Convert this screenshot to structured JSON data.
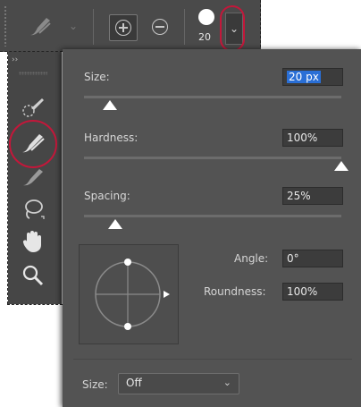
{
  "options_bar": {
    "brush_size_preview": "20",
    "icons": [
      "brush-icon",
      "chevron-down-icon",
      "add-to-selection-icon",
      "subtract-from-selection-icon",
      "brush-preview-icon",
      "dropdown-chevron-icon"
    ]
  },
  "toolbar": {
    "collapse_label": "››",
    "tools": [
      "quick-selection-icon",
      "selection-brush-icon",
      "refine-brush-icon",
      "lasso-icon",
      "hand-icon",
      "zoom-icon"
    ]
  },
  "brush_panel": {
    "size_label": "Size:",
    "size_value": "20 px",
    "size_fraction": 0.1,
    "hardness_label": "Hardness:",
    "hardness_value": "100%",
    "hardness_fraction": 1.0,
    "spacing_label": "Spacing:",
    "spacing_value": "25%",
    "spacing_fraction": 0.12,
    "angle_label": "Angle:",
    "angle_value": "0°",
    "roundness_label": "Roundness:",
    "roundness_value": "100%",
    "pen_size_label": "Size:",
    "pen_size_value": "Off"
  },
  "colors": {
    "panel_bg": "#535353",
    "highlight_ring": "#c3173a",
    "selection_blue": "#2a6fd6"
  }
}
